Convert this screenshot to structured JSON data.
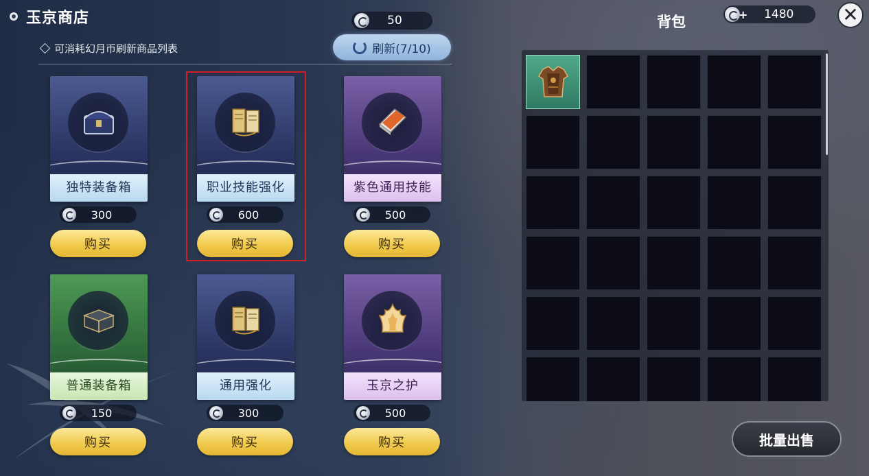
{
  "shop": {
    "title": "玉京商店",
    "currency_amount": "50",
    "hint": "可消耗幻月币刷新商品列表",
    "refresh_label": "刷新(7/10)",
    "items": [
      {
        "name": "独特装备箱",
        "price": "300",
        "buy": "购买",
        "theme": "blue",
        "icon": "treasure-chest-icon"
      },
      {
        "name": "职业技能强化",
        "price": "600",
        "buy": "购买",
        "theme": "blue",
        "icon": "skill-scroll-icon",
        "selected": true
      },
      {
        "name": "紫色通用技能",
        "price": "500",
        "buy": "购买",
        "theme": "purple",
        "icon": "skill-book-icon"
      },
      {
        "name": "普通装备箱",
        "price": "150",
        "buy": "购买",
        "theme": "green",
        "icon": "equipment-box-icon"
      },
      {
        "name": "通用强化",
        "price": "300",
        "buy": "购买",
        "theme": "blue",
        "icon": "skill-scroll-icon"
      },
      {
        "name": "玉京之护",
        "price": "500",
        "buy": "购买",
        "theme": "purple",
        "icon": "flame-emblem-icon"
      }
    ]
  },
  "bag": {
    "title": "背包",
    "currency_amount": "1480",
    "items": [
      {
        "slot": 1,
        "icon": "bronze-armor-icon"
      }
    ],
    "sell_label": "批量出售"
  },
  "colors": {
    "buy_button": "#f1cb4e",
    "refresh_button": "#a9c7e8",
    "selection_box": "#d11f24",
    "filled_slot": "#3f9176"
  }
}
